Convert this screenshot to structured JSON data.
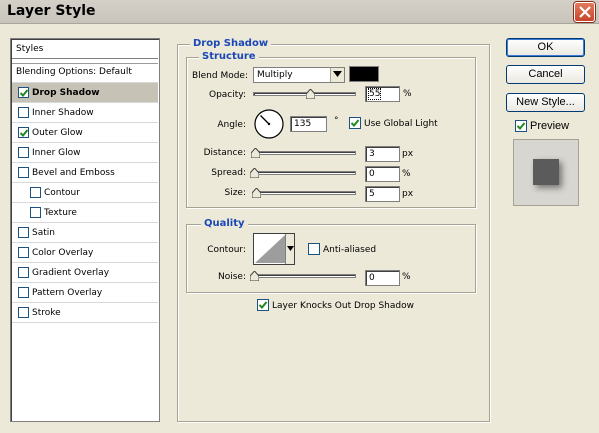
{
  "window": {
    "title": "Layer Style"
  },
  "styles_list": {
    "header": "Styles",
    "blending": "Blending Options: Default",
    "items": [
      {
        "label": "Drop Shadow",
        "checked": true,
        "selected": true,
        "indent": false
      },
      {
        "label": "Inner Shadow",
        "checked": false,
        "selected": false,
        "indent": false
      },
      {
        "label": "Outer Glow",
        "checked": true,
        "selected": false,
        "indent": false
      },
      {
        "label": "Inner Glow",
        "checked": false,
        "selected": false,
        "indent": false
      },
      {
        "label": "Bevel and Emboss",
        "checked": false,
        "selected": false,
        "indent": false
      },
      {
        "label": "Contour",
        "checked": false,
        "selected": false,
        "indent": true
      },
      {
        "label": "Texture",
        "checked": false,
        "selected": false,
        "indent": true
      },
      {
        "label": "Satin",
        "checked": false,
        "selected": false,
        "indent": false
      },
      {
        "label": "Color Overlay",
        "checked": false,
        "selected": false,
        "indent": false
      },
      {
        "label": "Gradient Overlay",
        "checked": false,
        "selected": false,
        "indent": false
      },
      {
        "label": "Pattern Overlay",
        "checked": false,
        "selected": false,
        "indent": false
      },
      {
        "label": "Stroke",
        "checked": false,
        "selected": false,
        "indent": false
      }
    ]
  },
  "drop_shadow": {
    "title": "Drop Shadow",
    "structure_title": "Structure",
    "blend_mode_label": "Blend Mode:",
    "blend_mode_value": "Multiply",
    "shadow_color": "#000000",
    "opacity_label": "Opacity:",
    "opacity_value": "55",
    "opacity_unit": "%",
    "opacity_fraction": 0.55,
    "angle_label": "Angle:",
    "angle_value": "135",
    "angle_unit": "°",
    "angle_degrees": 135,
    "use_global_light_label": "Use Global Light",
    "use_global_light": true,
    "distance_label": "Distance:",
    "distance_value": "3",
    "distance_unit": "px",
    "distance_fraction": 0.012,
    "spread_label": "Spread:",
    "spread_value": "0",
    "spread_unit": "%",
    "spread_fraction": 0,
    "size_label": "Size:",
    "size_value": "5",
    "size_unit": "px",
    "size_fraction": 0.02,
    "quality_title": "Quality",
    "contour_label": "Contour:",
    "anti_aliased_label": "Anti-aliased",
    "anti_aliased": false,
    "noise_label": "Noise:",
    "noise_value": "0",
    "noise_unit": "%",
    "noise_fraction": 0,
    "knockout_label": "Layer Knocks Out Drop Shadow",
    "knockout": true
  },
  "buttons": {
    "ok": "OK",
    "cancel": "Cancel",
    "new_style": "New Style...",
    "preview_label": "Preview",
    "preview_checked": true
  },
  "colors": {
    "accent": "#1a47b8",
    "checkmark": "#1f8a1f",
    "dialog_bg": "#ece9d8",
    "preview_swatch": "#5b5b5b"
  }
}
